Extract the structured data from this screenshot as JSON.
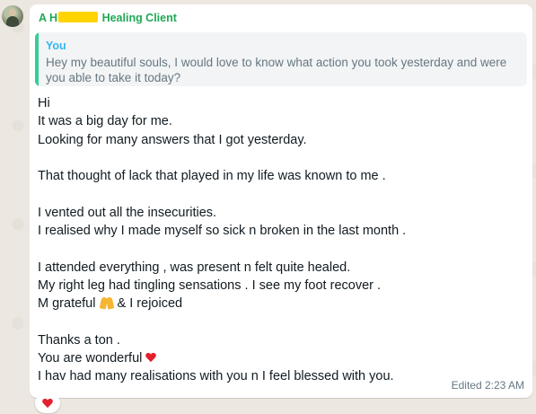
{
  "chat": {
    "sender": {
      "name_prefix": "A H",
      "name_suffix": "Healing Client",
      "color": "#1fa855"
    },
    "quoted_message": {
      "author": "You",
      "text": "Hey my beautiful souls, I would love to know what action you took yesterday and were you able to take it today?",
      "accent_color": "#35cd96"
    },
    "message": {
      "lines": [
        "Hi",
        "It was a big day for me.",
        "Looking  for many answers that I got yesterday.",
        "",
        "That thought  of lack that played in my life was known to me .",
        "",
        "I vented out all the insecurities.",
        "I realised why I made myself  so sick n broken in the last month .",
        "",
        "I attended  everything , was present  n felt quite healed.",
        "My right  leg had tingling sensations . I see my  foot recover .",
        "M grateful",
        "& I  rejoiced",
        "",
        "Thanks a ton .",
        "You are wonderful",
        "I hav had many realisations with you n I feel blessed with you."
      ],
      "timestamp": "Edited 2:23 AM"
    },
    "reaction": {
      "emoji": "red-heart-icon"
    },
    "icons": {
      "avatar": "contact-avatar",
      "pray": "folded-hands-icon",
      "heart": "red-heart-icon"
    }
  }
}
